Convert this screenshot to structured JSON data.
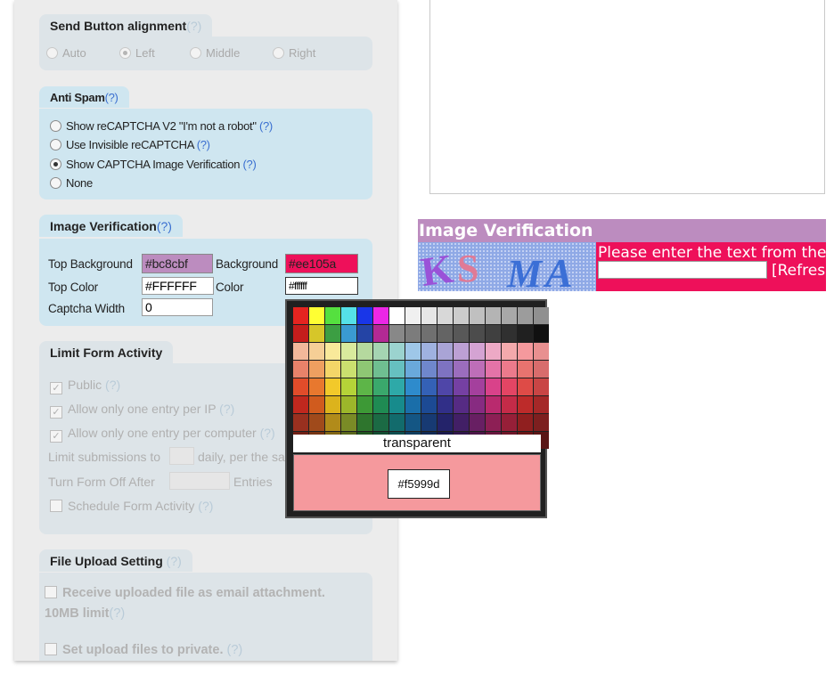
{
  "send_alignment": {
    "title": "Send Button alignment",
    "help": "(?)",
    "options": [
      "Auto",
      "Left",
      "Middle",
      "Right"
    ],
    "selected": "Left"
  },
  "anti_spam": {
    "title": "Anti Spam",
    "help": "(?)",
    "options": [
      {
        "label": "Show reCAPTCHA V2 \"I'm not a robot\"",
        "help": "(?)"
      },
      {
        "label": "Use Invisible reCAPTCHA",
        "help": "(?)"
      },
      {
        "label": "Show CAPTCHA Image Verification",
        "help": "(?)"
      },
      {
        "label": "None",
        "help": ""
      }
    ],
    "selected": "Show CAPTCHA Image Verification"
  },
  "image_verification": {
    "title": "Image Verification",
    "help": "(?)",
    "top_background_label": "Top Background",
    "top_background_value": "#bc8cbf",
    "background_label": "Background",
    "background_value": "#ee105a",
    "top_color_label": "Top Color",
    "top_color_value": "#FFFFFF",
    "color_label": "Color",
    "color_value": "#ffffff",
    "captcha_width_label": "Captcha Width",
    "captcha_width_value": "0"
  },
  "limit_form": {
    "title": "Limit Form Activity",
    "help": "(?)",
    "public_label": "Public",
    "one_ip_label": "Allow only one entry per IP",
    "one_computer_label": "Allow only one entry per computer",
    "limit_submissions_label": "Limit submissions to",
    "daily_label": "daily, per the sa",
    "turn_off_label": "Turn Form Off After",
    "entries_label": "Entries",
    "schedule_label": "Schedule Form Activity",
    "help_q": "(?)"
  },
  "file_upload": {
    "title": "File Upload Setting",
    "help": "(?)",
    "receive_label": "Receive uploaded file as email attachment.",
    "limit_label": "10MB limit",
    "private_label": "Set upload files to private.",
    "help_q": "(?)"
  },
  "preview": {
    "header": "Image Verification",
    "instruction": "Please enter the text from the",
    "refresh": "[Refres",
    "captcha_text": "KS MA"
  },
  "color_picker": {
    "transparent_label": "transparent",
    "current_hex": "#f5999d",
    "palette": [
      [
        "#e52420",
        "#ffff33",
        "#55e03f",
        "#55e1e8",
        "#1936e8",
        "#ec27e6",
        "#ffffff",
        "#f0f0f0",
        "#e6e6e6",
        "#d8d8d8",
        "#cccccc",
        "#c0c0c0",
        "#b4b4b4",
        "#a8a8a8",
        "#9c9c9c",
        "#909090"
      ],
      [
        "#c41d1c",
        "#d6c629",
        "#3c9e43",
        "#3a9ad1",
        "#2444a5",
        "#b32994",
        "#888888",
        "#7c7c7c",
        "#707070",
        "#646464",
        "#585858",
        "#4c4c4c",
        "#404040",
        "#303030",
        "#202020",
        "#101010"
      ],
      [
        "#f2b89a",
        "#f6cf96",
        "#f9e99a",
        "#d9ea9d",
        "#b5d99e",
        "#a5d4b2",
        "#9bd3cf",
        "#9ec7e8",
        "#9fb2e0",
        "#a9a4d6",
        "#bca0d4",
        "#d4a3d3",
        "#eda9c5",
        "#f3a9ac",
        "#f5999d",
        "#e89090"
      ],
      [
        "#e8826a",
        "#ee9f60",
        "#f4d668",
        "#cbe06f",
        "#8ec774",
        "#6fbe91",
        "#66c0c0",
        "#6aa9db",
        "#6f87cc",
        "#7e73c1",
        "#9b6dbd",
        "#be6eb8",
        "#e473a8",
        "#ec7a8c",
        "#e8736f",
        "#d86c6c"
      ],
      [
        "#e14c2a",
        "#e8782e",
        "#f2c92a",
        "#b5d338",
        "#5db548",
        "#3aa86c",
        "#2ea9a8",
        "#2e8bcc",
        "#3461b6",
        "#4f46a8",
        "#7540a3",
        "#a4409d",
        "#d9428a",
        "#e34564",
        "#de4b47",
        "#c94545"
      ],
      [
        "#c0281e",
        "#d05b1e",
        "#dcb31c",
        "#9cb62a",
        "#3d9936",
        "#1f8b53",
        "#178b8c",
        "#1a6ea9",
        "#1c4a94",
        "#312f88",
        "#562b84",
        "#872b81",
        "#b92a6e",
        "#c42b48",
        "#bd2b2a",
        "#a52828"
      ],
      [
        "#99301f",
        "#a04a1b",
        "#b18b1a",
        "#7a8b26",
        "#2e752d",
        "#1b6a44",
        "#126b6c",
        "#145684",
        "#173a73",
        "#24236a",
        "#421f66",
        "#681f63",
        "#8d1f55",
        "#961f38",
        "#901f1f",
        "#7d1f1f"
      ],
      [
        "#6e1f15",
        "#753413",
        "#806514",
        "#59661b",
        "#205420",
        "#134c31",
        "#0e4d4e",
        "#0f3d5e",
        "#112a53",
        "#1a194c",
        "#30164a",
        "#4b1647",
        "#66163d",
        "#6d1628",
        "#681616",
        "#5a1616"
      ]
    ]
  }
}
